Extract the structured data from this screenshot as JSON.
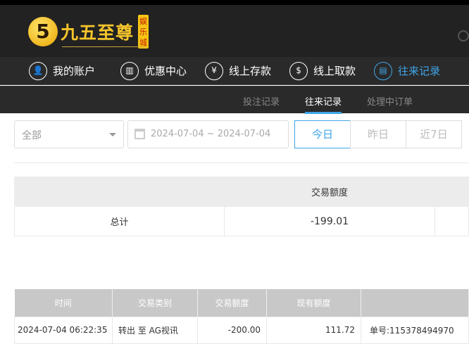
{
  "brand": {
    "logo_text": "九五至尊",
    "logo_badge": "娱乐城",
    "logo_mark": "5"
  },
  "nav": {
    "items": [
      {
        "label": "我的账户",
        "icon": "user-icon"
      },
      {
        "label": "优惠中心",
        "icon": "gift-icon"
      },
      {
        "label": "线上存款",
        "icon": "deposit-icon"
      },
      {
        "label": "线上取款",
        "icon": "withdraw-icon"
      },
      {
        "label": "往来记录",
        "icon": "records-icon",
        "active": true
      }
    ]
  },
  "subnav": {
    "items": [
      "投注记录",
      "往来记录",
      "处理中订单"
    ],
    "active": "往来记录"
  },
  "filters": {
    "type_value": "全部",
    "date_range": "2024-07-04 ~ 2024-07-04",
    "buttons": [
      "今日",
      "昨日",
      "近7日"
    ],
    "active_button": "今日"
  },
  "summary": {
    "header": "交易额度",
    "total_label": "总计",
    "total_value": "-199.01"
  },
  "table": {
    "columns": [
      "时间",
      "交易类别",
      "交易额度",
      "现有额度",
      ""
    ],
    "rows": [
      {
        "time": "2024-07-04 06:22:35",
        "type": "转出 至 AG视讯",
        "amount": "-200.00",
        "balance": "111.72",
        "note": "单号:115378494970"
      }
    ]
  },
  "colors": {
    "accent": "#3fa5e8",
    "header_bg": "#222222",
    "logo_gold": "#f6c52b"
  }
}
